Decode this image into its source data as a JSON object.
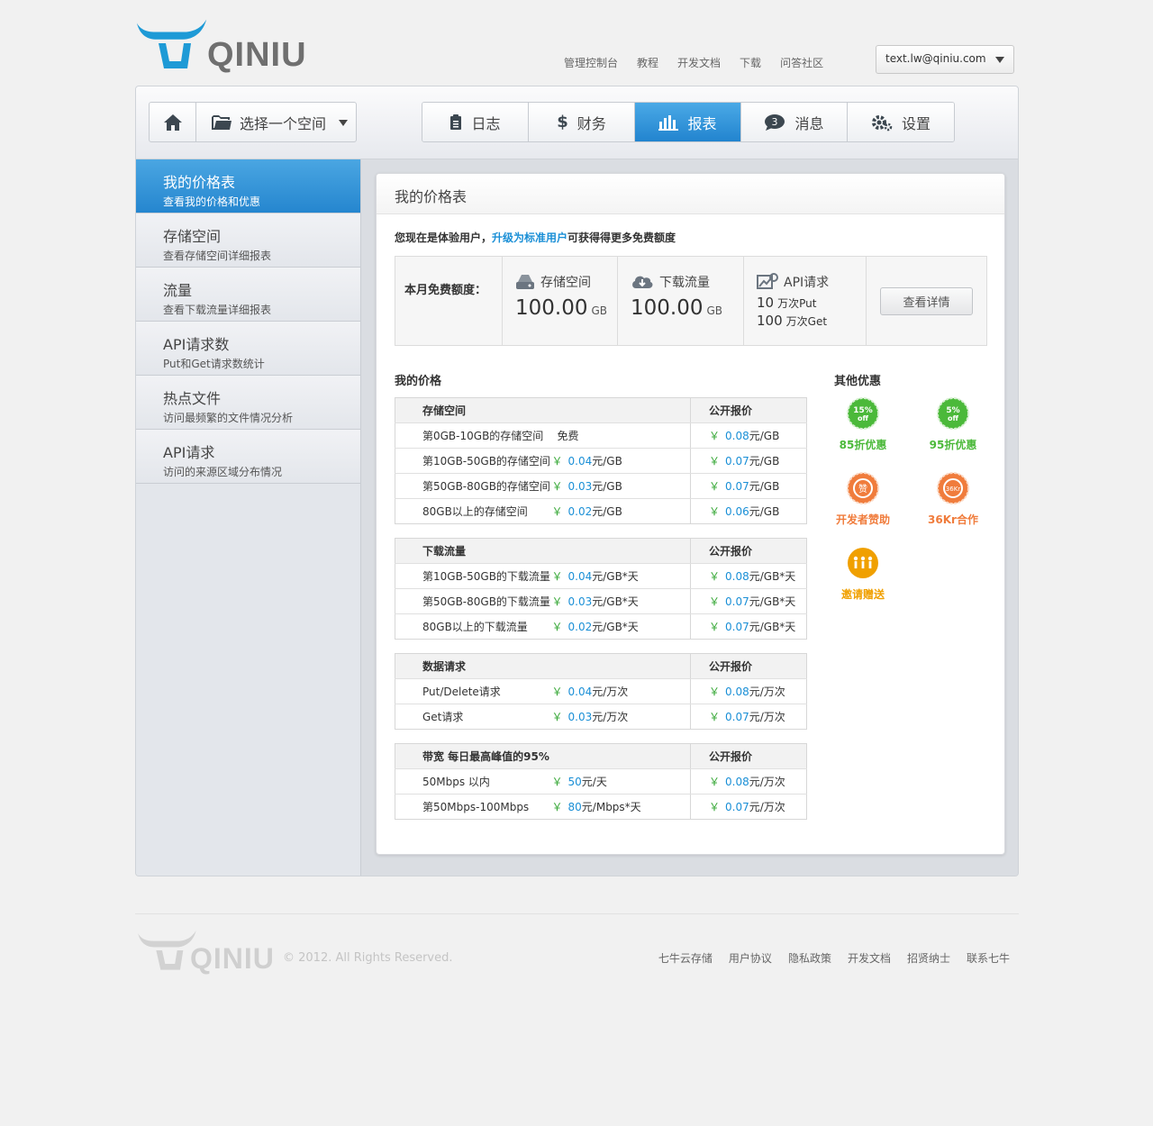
{
  "brand": {
    "name": "QINIU"
  },
  "top_nav": [
    "管理控制台",
    "教程",
    "开发文档",
    "下载",
    "问答社区"
  ],
  "user": {
    "email": "text.lw@qiniu.com"
  },
  "space_select": {
    "label": "选择一个空间"
  },
  "tabs": [
    {
      "label": "日志",
      "icon": "log-icon"
    },
    {
      "label": "财务",
      "icon": "dollar-icon"
    },
    {
      "label": "报表",
      "icon": "bar-chart-icon",
      "active": true
    },
    {
      "label": "消息",
      "icon": "message-icon",
      "badge": "3"
    },
    {
      "label": "设置",
      "icon": "gear-icon"
    }
  ],
  "sidebar": [
    {
      "title": "我的价格表",
      "sub": "查看我的价格和优惠",
      "active": true
    },
    {
      "title": "存储空间",
      "sub": "查看存储空间详细报表"
    },
    {
      "title": "流量",
      "sub": "查看下载流量详细报表"
    },
    {
      "title": "API请求数",
      "sub": "Put和Get请求数统计"
    },
    {
      "title": "热点文件",
      "sub": "访问最频繁的文件情况分析"
    },
    {
      "title": "API请求",
      "sub": "访问的来源区域分布情况"
    }
  ],
  "card": {
    "title": "我的价格表",
    "notice_pre": "您现在是体验用户，",
    "notice_link": "升级为标准用户",
    "notice_post": "可获得得更多免费额度"
  },
  "quota": {
    "label": "本月免费额度：",
    "storage": {
      "title": "存储空间",
      "value": "100.00",
      "unit": "GB"
    },
    "download": {
      "title": "下载流量",
      "value": "100.00",
      "unit": "GB"
    },
    "api": {
      "title": "API请求",
      "put_value": "10",
      "put_unit": "万次Put",
      "get_value": "100",
      "get_unit": "万次Get"
    },
    "detail_button": "查看详情"
  },
  "prices": {
    "title": "我的价格",
    "yen": "￥",
    "tables": [
      {
        "name": "存储空间",
        "public": "公开报价",
        "rows": [
          {
            "label": "第0GB-10GB的存储空间",
            "free": "免费",
            "pub": "0.08",
            "pub_unit": "元/GB"
          },
          {
            "label": "第10GB-50GB的存储空间",
            "mine": "0.04",
            "mine_unit": "元/GB",
            "pub": "0.07",
            "pub_unit": "元/GB"
          },
          {
            "label": "第50GB-80GB的存储空间",
            "mine": "0.03",
            "mine_unit": "元/GB",
            "pub": "0.07",
            "pub_unit": "元/GB"
          },
          {
            "label": "80GB以上的存储空间",
            "mine": "0.02",
            "mine_unit": "元/GB",
            "pub": "0.06",
            "pub_unit": "元/GB"
          }
        ]
      },
      {
        "name": "下载流量",
        "public": "公开报价",
        "rows": [
          {
            "label": "第10GB-50GB的下载流量",
            "mine": "0.04",
            "mine_unit": "元/GB*天",
            "pub": "0.08",
            "pub_unit": "元/GB*天"
          },
          {
            "label": "第50GB-80GB的下载流量",
            "mine": "0.03",
            "mine_unit": "元/GB*天",
            "pub": "0.07",
            "pub_unit": "元/GB*天"
          },
          {
            "label": "80GB以上的下载流量",
            "mine": "0.02",
            "mine_unit": "元/GB*天",
            "pub": "0.07",
            "pub_unit": "元/GB*天"
          }
        ]
      },
      {
        "name": "数据请求",
        "public": "公开报价",
        "rows": [
          {
            "label": "Put/Delete请求",
            "mine": "0.04",
            "mine_unit": "元/万次",
            "pub": "0.08",
            "pub_unit": "元/万次"
          },
          {
            "label": "Get请求",
            "mine": "0.03",
            "mine_unit": "元/万次",
            "pub": "0.07",
            "pub_unit": "元/万次"
          }
        ]
      },
      {
        "name": "带宽 每日最高峰值的95%",
        "public": "公开报价",
        "rows": [
          {
            "label": "50Mbps 以内",
            "mine": "50",
            "mine_unit": "元/天",
            "pub": "0.08",
            "pub_unit": "元/万次"
          },
          {
            "label": "第50Mbps-100Mbps",
            "mine": "80",
            "mine_unit": "元/Mbps*天",
            "pub": "0.07",
            "pub_unit": "元/万次"
          }
        ]
      }
    ]
  },
  "perks": {
    "title": "其他优惠",
    "items": [
      {
        "badge": "15%",
        "badge2": "off",
        "label": "85折优惠",
        "color": "#4bb93a"
      },
      {
        "badge": "5%",
        "badge2": "off",
        "label": "95折优惠",
        "color": "#4bb93a"
      },
      {
        "badge": "赞",
        "label": "开发者赞助",
        "color": "#f07c3c"
      },
      {
        "badge": "36Kr",
        "label": "36Kr合作",
        "color": "#f07c3c"
      },
      {
        "badge": "人",
        "label": "邀请赠送",
        "color": "#f0a000"
      }
    ]
  },
  "footer": {
    "brand": "QINIU",
    "copyright": "© 2012. All Rights Reserved.",
    "links": [
      "七牛云存储",
      "用户协议",
      "隐私政策",
      "开发文档",
      "招贤纳士",
      "联系七牛"
    ]
  }
}
